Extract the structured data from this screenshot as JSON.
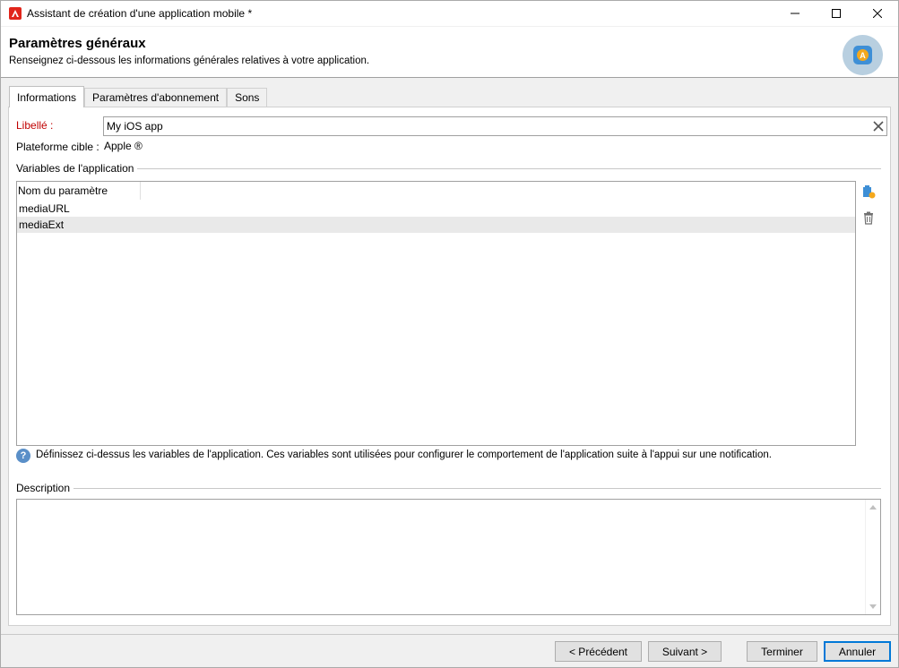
{
  "window": {
    "title": "Assistant de création d'une application mobile *"
  },
  "header": {
    "title": "Paramètres généraux",
    "subtitle": "Renseignez ci-dessous les informations générales relatives à votre application.",
    "icon_badge": "A"
  },
  "tabs": [
    {
      "label": "Informations",
      "active": true
    },
    {
      "label": "Paramètres d'abonnement",
      "active": false
    },
    {
      "label": "Sons",
      "active": false
    }
  ],
  "form": {
    "libelle_label": "Libellé :",
    "libelle_value": "My iOS app",
    "platform_label": "Plateforme cible :",
    "platform_value": "Apple ®"
  },
  "variables": {
    "group_title": "Variables de l'application",
    "column_header": "Nom du paramètre",
    "rows": [
      "mediaURL",
      "mediaExt"
    ],
    "selected_index": 1,
    "help_text": "Définissez ci-dessus les variables de l'application. Ces variables sont utilisées pour configurer le comportement de l'application suite à l'appui sur une notification."
  },
  "description": {
    "group_title": "Description",
    "value": ""
  },
  "footer": {
    "prev": "< Précédent",
    "next": "Suivant >",
    "finish": "Terminer",
    "cancel": "Annuler"
  },
  "colors": {
    "label_required": "#c00000",
    "accent": "#0078d7",
    "brand": "#e1251b"
  }
}
